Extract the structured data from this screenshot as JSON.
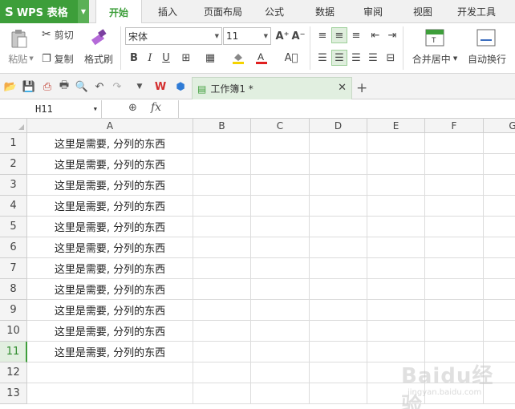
{
  "app": {
    "logo": "S",
    "name": "WPS 表格"
  },
  "menu_tabs": [
    "开始",
    "插入",
    "页面布局",
    "公式",
    "数据",
    "审阅",
    "视图",
    "开发工具"
  ],
  "active_tab": "开始",
  "ribbon": {
    "paste": "粘贴",
    "cut": "剪切",
    "copy": "复制",
    "format_painter": "格式刷",
    "font_name": "宋体",
    "font_size": "11",
    "bold": "B",
    "italic": "I",
    "underline": "U",
    "font_grow": "A⁺",
    "font_shrink": "A⁻",
    "merge_center": "合并居中",
    "wrap_text": "自动换行"
  },
  "document_tab": {
    "title": "工作簿1 *"
  },
  "formula_bar": {
    "cell_ref": "H11",
    "fx": "fx",
    "value": ""
  },
  "sheet": {
    "columns": [
      "A",
      "B",
      "C",
      "D",
      "E",
      "F",
      "G"
    ],
    "rows": [
      "1",
      "2",
      "3",
      "4",
      "5",
      "6",
      "7",
      "8",
      "9",
      "10",
      "11",
      "12",
      "13"
    ],
    "selected_row": "11",
    "cells_a": [
      "这里是需要, 分列的东西",
      "这里是需要, 分列的东西",
      "这里是需要, 分列的东西",
      "这里是需要, 分列的东西",
      "这里是需要, 分列的东西",
      "这里是需要, 分列的东西",
      "这里是需要, 分列的东西",
      "这里是需要, 分列的东西",
      "这里是需要, 分列的东西",
      "这里是需要, 分列的东西",
      "这里是需要, 分列的东西",
      "",
      ""
    ]
  },
  "watermark": {
    "line1": "Baidu经验",
    "line2": "jingyan.baidu.com"
  },
  "colors": {
    "accent": "#3d9e3a",
    "selected_row_bg": "#e2efe0"
  }
}
